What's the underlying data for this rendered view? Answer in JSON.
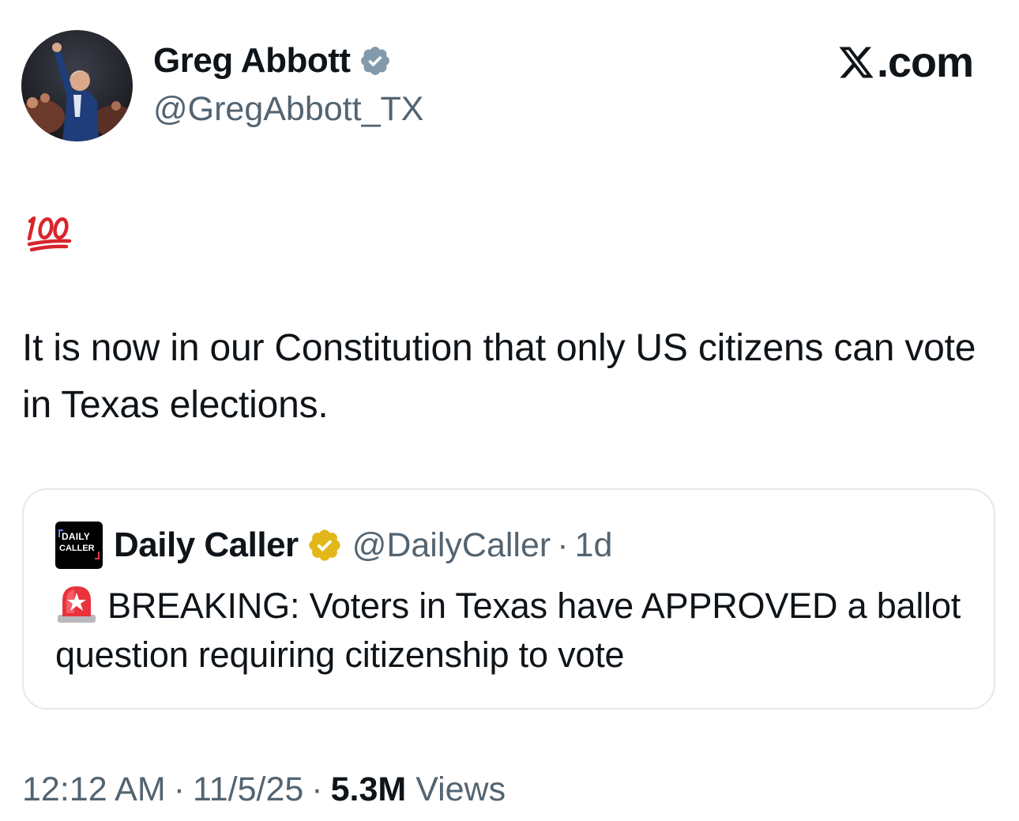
{
  "author": {
    "display_name": "Greg Abbott",
    "handle": "@GregAbbott_TX",
    "verified_badge_color": "#829aab"
  },
  "site": {
    "logo_text": ".com",
    "logo_icon": "x-logo-icon"
  },
  "tweet": {
    "emoji": "100-emoji-icon",
    "text": "It is now in our Constitution that only US citizens can vote in Texas elections."
  },
  "quoted_tweet": {
    "logo_line1": "DAILY",
    "logo_line2": "CALLER",
    "display_name": "Daily Caller",
    "verified_badge_color": "#e2b719",
    "handle": "@DailyCaller",
    "separator": "·",
    "time": "1d",
    "emoji": "police-siren-emoji-icon",
    "text": "BREAKING: Voters in Texas have APPROVED a ballot question requiring citizenship to vote"
  },
  "meta": {
    "time": "12:12 AM",
    "separator": "·",
    "date": "11/5/25",
    "views_count": "5.3M",
    "views_label": "Views"
  },
  "colors": {
    "text_primary": "#0f1419",
    "text_secondary": "#536471",
    "border": "#e4e9ec",
    "emoji_red": "#d8252d"
  }
}
